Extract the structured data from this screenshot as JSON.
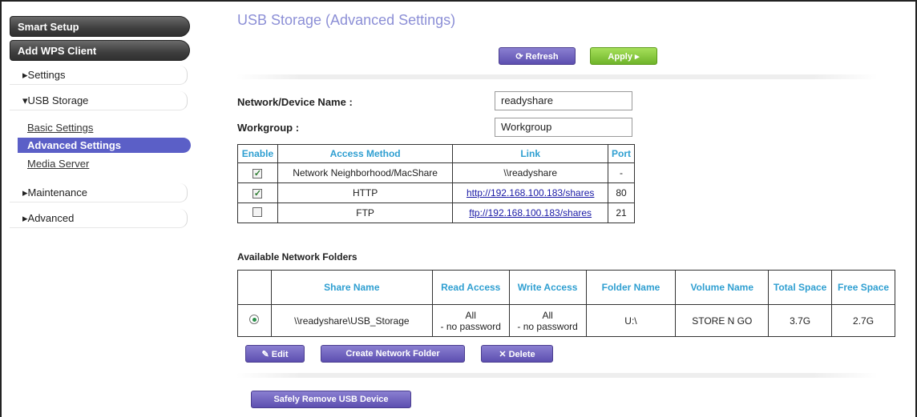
{
  "sidebar": {
    "smart_setup": "Smart Setup",
    "add_wps": "Add WPS Client",
    "settings": "▸Settings",
    "usb_storage": "▾USB Storage",
    "basic_settings": "Basic Settings",
    "advanced_settings": "Advanced Settings",
    "media_server": "Media Server",
    "maintenance": "▸Maintenance",
    "advanced": "▸Advanced"
  },
  "page": {
    "title": "USB Storage (Advanced Settings)",
    "refresh_label": "⟳ Refresh",
    "apply_label": "Apply ▸",
    "device_name_label": "Network/Device Name :",
    "device_name_value": "readyshare",
    "workgroup_label": "Workgroup :",
    "workgroup_value": "Workgroup"
  },
  "access_table": {
    "headers": [
      "Enable",
      "Access Method",
      "Link",
      "Port"
    ],
    "rows": [
      {
        "enabled": true,
        "method": "Network Neighborhood/MacShare",
        "link": "\\\\readyshare",
        "port": "-"
      },
      {
        "enabled": true,
        "method": "HTTP",
        "link": "http://192.168.100.183/shares",
        "port": "80"
      },
      {
        "enabled": false,
        "method": "FTP",
        "link": "ftp://192.168.100.183/shares",
        "port": "21"
      }
    ]
  },
  "folders": {
    "heading": "Available Network Folders",
    "headers": [
      "Share Name",
      "Read Access",
      "Write Access",
      "Folder Name",
      "Volume Name",
      "Total Space",
      "Free Space"
    ],
    "rows": [
      {
        "selected": true,
        "share_name": "\\\\readyshare\\USB_Storage",
        "read": "All\n- no password",
        "write": "All\n- no password",
        "folder": "U:\\",
        "volume": "STORE N GO",
        "total": "3.7G",
        "free": "2.7G"
      }
    ],
    "edit_label": "✎ Edit",
    "create_label": "Create Network Folder",
    "delete_label": "✕ Delete",
    "safely_remove_label": "Safely Remove USB Device"
  },
  "colors": {
    "accent": "#5b5fc7",
    "apply": "#7cc236",
    "header_text": "#2f9fd1",
    "title": "#8c8fd6"
  }
}
